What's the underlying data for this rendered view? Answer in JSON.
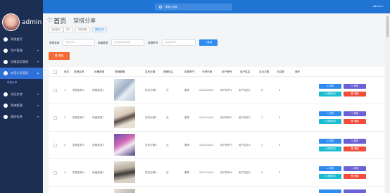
{
  "header": {
    "search_placeholder": "请输入搜索",
    "user": "admin"
  },
  "sidebar": {
    "brand": "admin",
    "items": [
      {
        "label": "系统首页"
      },
      {
        "label": "用户管理"
      },
      {
        "label": "风格类型管理"
      },
      {
        "label": "穿搭分享管理"
      },
      {
        "label": "论坛交流"
      },
      {
        "label": "系统管理"
      },
      {
        "label": "我的信息"
      }
    ],
    "sub_active": "穿搭分享"
  },
  "page": {
    "title": "首页",
    "subtitle": "穿搭分享",
    "tabs": [
      "系统首页",
      "用户",
      "风格类型",
      "穿搭分享"
    ]
  },
  "search": {
    "name_label": "穿搭名称",
    "name_placeholder": "穿搭名称",
    "style_label": "风格类型",
    "style_placeholder": "请选择风格类型",
    "season_label": "穿搭季节",
    "season_placeholder": "请选择季节",
    "search_button": "查询"
  },
  "toolbar": {
    "delete_label": "删除"
  },
  "table": {
    "headers": [
      "索引",
      "穿搭名称",
      "风格类型",
      "穿搭图像",
      "发布日期",
      "视频标注",
      "穿搭季节",
      "分享时间",
      "用户账号",
      "用户姓名",
      "点击次数",
      "评论数",
      "操作"
    ],
    "rows": [
      {
        "index": "1",
        "name": "穿搭名称1",
        "style": "风格类型1",
        "date": "发布日期1",
        "video": "无",
        "season": "春季",
        "time": "2024-04-01",
        "account": "用户账号1",
        "user": "用户姓名1",
        "clicks": "6",
        "comments": "0"
      },
      {
        "index": "2",
        "name": "穿搭名称2",
        "style": "风格类型2",
        "date": "发布日期2",
        "video": "无",
        "season": "春季",
        "time": "2024-04-01",
        "account": "用户账号2",
        "user": "用户姓名2",
        "clicks": "7",
        "comments": "0"
      },
      {
        "index": "3",
        "name": "穿搭名称3",
        "style": "风格类型3",
        "date": "发布日期3",
        "video": "无",
        "season": "春季",
        "time": "2024-04-01",
        "account": "用户账号3",
        "user": "用户姓名3",
        "clicks": "3",
        "comments": "0"
      },
      {
        "index": "4",
        "name": "穿搭名称4",
        "style": "风格类型4",
        "date": "发布日期4",
        "video": "无",
        "season": "春季",
        "time": "2024-04-01",
        "account": "用户账号4",
        "user": "用户姓名4",
        "clicks": "4",
        "comments": "0"
      }
    ],
    "actions": {
      "detail": "详情",
      "edit": "修改",
      "comments": "查看评论",
      "delete": "删除"
    }
  },
  "colors": {
    "sidebar": "#1d2e53",
    "topbar": "#1f74d4",
    "accent": "#2e8cf0",
    "danger": "#f24c3c"
  }
}
